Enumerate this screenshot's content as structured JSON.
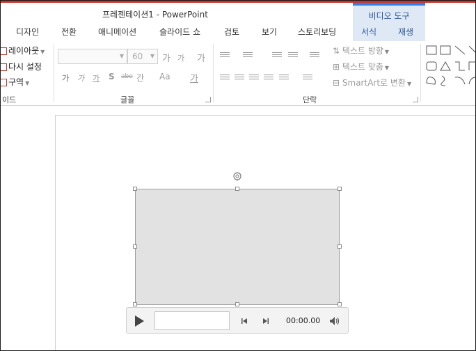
{
  "window": {
    "title": "프레젠테이션1 - PowerPoint",
    "context_group": "비디오 도구"
  },
  "tabs": [
    "디자인",
    "전환",
    "애니메이션",
    "슬라이드 쇼",
    "검토",
    "보기",
    "스토리보딩",
    "서식",
    "재생"
  ],
  "ribbon": {
    "slides_group": {
      "layout": "레이아웃",
      "reset": "다시 설정",
      "section": "구역",
      "label": "이드"
    },
    "font_group": {
      "label": "글꼴",
      "font_name": "",
      "font_size": "60",
      "grow": "가",
      "shrink": "가",
      "clear": "가",
      "bold": "가",
      "italic": "가",
      "underline": "가",
      "shadow": "S",
      "strike": "abe",
      "spacing": "간",
      "case": "Aa",
      "color": "가"
    },
    "paragraph_group": {
      "label": "단락",
      "text_direction": "텍스트 방향",
      "align_text": "텍스트 맞춤",
      "smartart": "SmartArt로 변환"
    }
  },
  "player": {
    "time": "00:00.00"
  }
}
